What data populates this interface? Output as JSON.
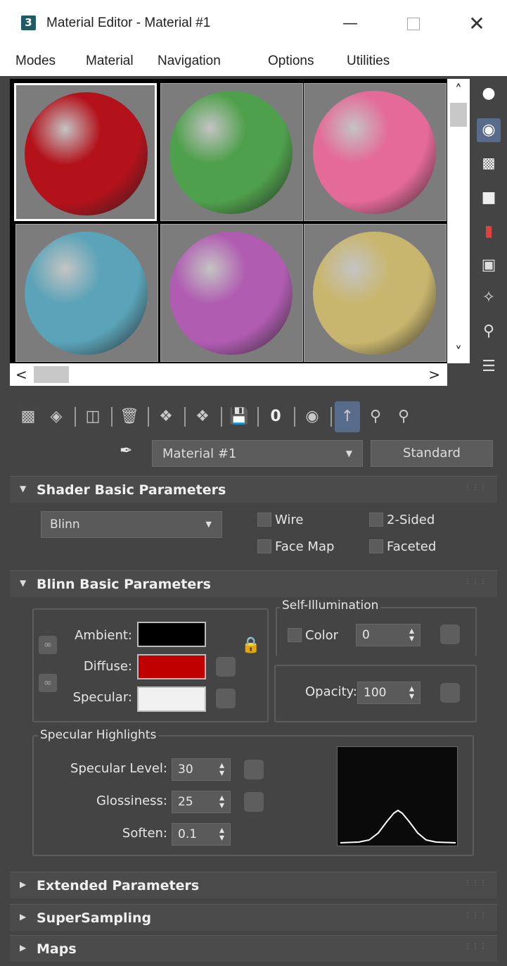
{
  "window": {
    "title": "Material Editor - Material #1",
    "app_icon_text": "3"
  },
  "menu": [
    "Modes",
    "Material",
    "Navigation",
    "Options",
    "Utilities"
  ],
  "preview": {
    "slots": [
      {
        "color": "#b3121b",
        "selected": true
      },
      {
        "color": "#4fa04c",
        "selected": false
      },
      {
        "color": "#e46a97",
        "selected": false
      },
      {
        "color": "#5ba3b8",
        "selected": false
      },
      {
        "color": "#b05cb1",
        "selected": false
      },
      {
        "color": "#c9b66e",
        "selected": false
      }
    ]
  },
  "material": {
    "name": "Material #1",
    "type": "Standard"
  },
  "shader_basic": {
    "title": "Shader Basic Parameters",
    "shader": "Blinn",
    "wire": "Wire",
    "two_sided": "2-Sided",
    "face_map": "Face Map",
    "faceted": "Faceted"
  },
  "blinn_basic": {
    "title": "Blinn Basic Parameters",
    "ambient_label": "Ambient:",
    "diffuse_label": "Diffuse:",
    "specular_label": "Specular:",
    "ambient_color": "#000000",
    "diffuse_color": "#c00000",
    "specular_color": "#f0f0f0",
    "self_illum_title": "Self-Illumination",
    "self_illum_color_label": "Color",
    "self_illum_value": "0",
    "opacity_label": "Opacity:",
    "opacity_value": "100"
  },
  "specular_highlights": {
    "title": "Specular Highlights",
    "level_label": "Specular Level:",
    "level_value": "30",
    "gloss_label": "Glossiness:",
    "gloss_value": "25",
    "soften_label": "Soften:",
    "soften_value": "0.1"
  },
  "collapsed_rollouts": [
    "Extended Parameters",
    "SuperSampling",
    "Maps"
  ]
}
